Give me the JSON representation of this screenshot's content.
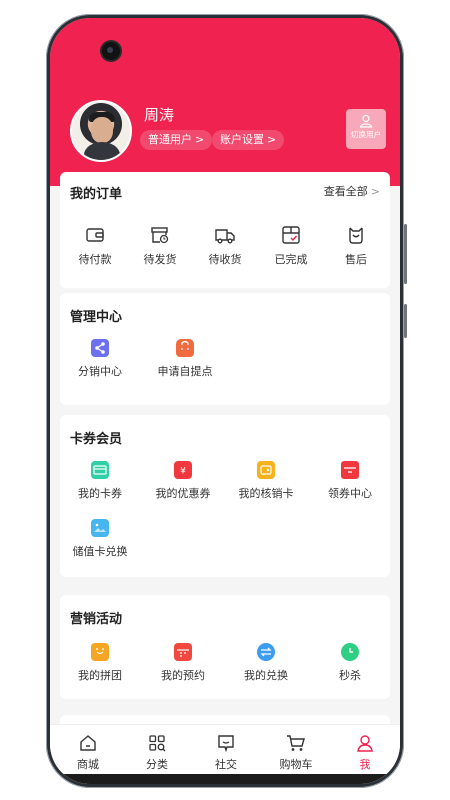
{
  "profile": {
    "name": "周涛",
    "user_level": "普通用户",
    "account_settings": "账户设置",
    "switch_user": "切换用户"
  },
  "orders": {
    "title": "我的订单",
    "view_all": "查看全部",
    "items": [
      {
        "label": "待付款",
        "icon": "wallet-icon"
      },
      {
        "label": "待发货",
        "icon": "box-clock-icon"
      },
      {
        "label": "待收货",
        "icon": "truck-icon"
      },
      {
        "label": "已完成",
        "icon": "package-check-icon"
      },
      {
        "label": "售后",
        "icon": "after-sales-icon"
      }
    ]
  },
  "management": {
    "title": "管理中心",
    "items": [
      {
        "label": "分销中心",
        "icon": "share-icon",
        "color": "#6b6ff0"
      },
      {
        "label": "申请自提点",
        "icon": "bag-icon",
        "color": "#f26b3f"
      }
    ]
  },
  "coupons": {
    "title": "卡券会员",
    "items": [
      {
        "label": "我的卡券",
        "icon": "card-icon",
        "color": "#2fd0a5"
      },
      {
        "label": "我的优惠券",
        "icon": "coupon-icon",
        "color": "#f0383e"
      },
      {
        "label": "我的核销卡",
        "icon": "verify-card-icon",
        "color": "#f5b21b"
      },
      {
        "label": "领券中心",
        "icon": "coupon-center-icon",
        "color": "#f0383e"
      },
      {
        "label": "储值卡兑换",
        "icon": "stored-card-icon",
        "color": "#47b6f0"
      }
    ]
  },
  "marketing": {
    "title": "营销活动",
    "items": [
      {
        "label": "我的拼团",
        "icon": "group-buy-icon",
        "color": "#f5a623"
      },
      {
        "label": "我的预约",
        "icon": "calendar-icon",
        "color": "#f0473e"
      },
      {
        "label": "我的兑换",
        "icon": "exchange-icon",
        "color": "#3c9df0"
      },
      {
        "label": "秒杀",
        "icon": "clock-icon",
        "color": "#2ecf84"
      }
    ]
  },
  "tabbar": {
    "items": [
      {
        "label": "商城",
        "icon": "home-icon"
      },
      {
        "label": "分类",
        "icon": "category-icon"
      },
      {
        "label": "社交",
        "icon": "chat-icon"
      },
      {
        "label": "购物车",
        "icon": "cart-icon"
      },
      {
        "label": "我",
        "icon": "user-icon"
      }
    ],
    "active_index": 4,
    "active_color": "#f0224f"
  },
  "colors": {
    "brand": "#f0224f"
  }
}
